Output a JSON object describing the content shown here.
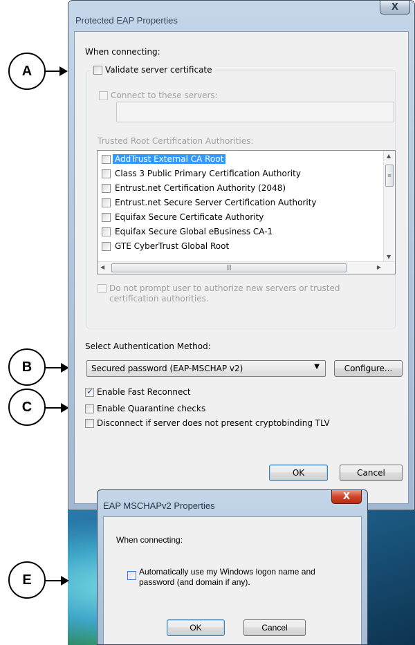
{
  "callouts": {
    "a": "A",
    "b": "B",
    "c": "C",
    "e": "E"
  },
  "peap_window": {
    "title": "Protected EAP Properties",
    "close_label": "X",
    "when_connecting": "When connecting:",
    "validate_cert": {
      "label": "Validate server certificate",
      "checked": false
    },
    "connect_servers": {
      "label": "Connect to these servers:",
      "checked": false,
      "value": ""
    },
    "trusted_root_label": "Trusted Root Certification Authorities:",
    "ca_list": [
      {
        "label": "AddTrust External CA Root",
        "checked": false,
        "selected": true
      },
      {
        "label": "Class 3 Public Primary Certification Authority",
        "checked": false
      },
      {
        "label": "Entrust.net Certification Authority (2048)",
        "checked": false
      },
      {
        "label": "Entrust.net Secure Server Certification Authority",
        "checked": false
      },
      {
        "label": "Equifax Secure Certificate Authority",
        "checked": false
      },
      {
        "label": "Equifax Secure Global eBusiness CA-1",
        "checked": false
      },
      {
        "label": "GTE CyberTrust Global Root",
        "checked": false
      }
    ],
    "no_prompt": {
      "line1": "Do not prompt user to authorize new servers or trusted",
      "line2": "certification authorities.",
      "checked": false
    },
    "auth_method_label": "Select Authentication Method:",
    "auth_method_value": "Secured password (EAP-MSCHAP v2)",
    "configure_label": "Configure...",
    "fast_reconnect": {
      "label": "Enable Fast Reconnect",
      "checked": true
    },
    "quarantine": {
      "label": "Enable Quarantine checks",
      "checked": false
    },
    "cryptobinding": {
      "label": "Disconnect if server does not present cryptobinding TLV",
      "checked": false
    },
    "ok_label": "OK",
    "cancel_label": "Cancel"
  },
  "mschap_dialog": {
    "title": "EAP MSCHAPv2 Properties",
    "close_label": "X",
    "when_connecting": "When connecting:",
    "auto_logon": {
      "line1": "Automatically use my Windows logon name and",
      "line2": "password (and domain if any).",
      "checked": false
    },
    "ok_label": "OK",
    "cancel_label": "Cancel"
  }
}
